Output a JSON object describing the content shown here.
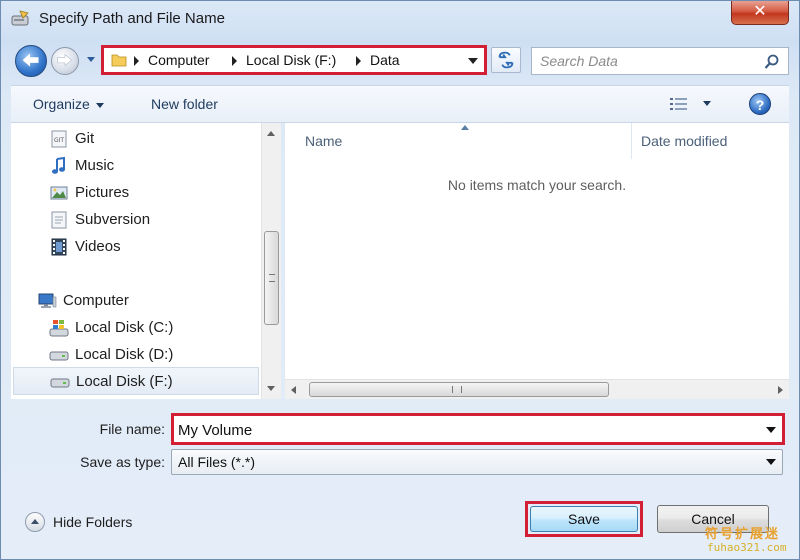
{
  "window": {
    "title": "Specify Path and File Name",
    "close_label": "✕"
  },
  "address": {
    "crumbs": [
      "Computer",
      "Local Disk (F:)",
      "Data"
    ]
  },
  "search": {
    "placeholder": "Search Data"
  },
  "toolbar": {
    "organize_label": "Organize",
    "new_folder_label": "New folder",
    "help_label": "?"
  },
  "nav_pane": {
    "items": [
      {
        "label": "Git",
        "icon": "git-icon"
      },
      {
        "label": "Music",
        "icon": "music-icon"
      },
      {
        "label": "Pictures",
        "icon": "pictures-icon"
      },
      {
        "label": "Subversion",
        "icon": "subversion-icon"
      },
      {
        "label": "Videos",
        "icon": "videos-icon"
      },
      {
        "label": "Computer",
        "icon": "computer-icon"
      },
      {
        "label": "Local Disk (C:)",
        "icon": "windows-drive-icon"
      },
      {
        "label": "Local Disk (D:)",
        "icon": "drive-icon"
      },
      {
        "label": "Local Disk (F:)",
        "icon": "drive-icon",
        "selected": true
      }
    ]
  },
  "file_list": {
    "columns": [
      "Name",
      "Date modified"
    ],
    "empty_message": "No items match your search."
  },
  "form": {
    "file_name_label": "File name:",
    "file_name_value": "My Volume",
    "save_type_label": "Save as type:",
    "save_type_value": "All Files (*.*)"
  },
  "footer": {
    "hide_folders_label": "Hide Folders",
    "save_label": "Save",
    "cancel_label": "Cancel"
  },
  "watermark": {
    "cn": "符号扩展迷",
    "en": "fuhao321.com"
  },
  "colors": {
    "highlight_red": "#d21f36",
    "accent_blue": "#2f73c9"
  }
}
